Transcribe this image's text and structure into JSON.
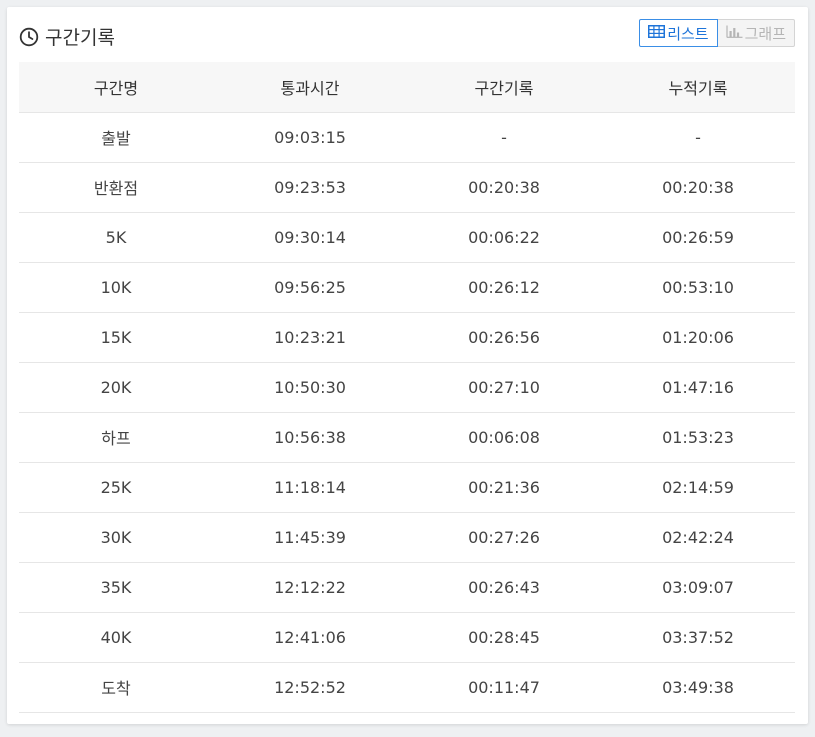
{
  "panel": {
    "title": "구간기록",
    "icon": "clock-icon"
  },
  "view_toggle": {
    "list_label": "리스트",
    "graph_label": "그래프",
    "active": "list",
    "accent_color": "#1e74d9"
  },
  "table": {
    "headers": [
      "구간명",
      "통과시간",
      "구간기록",
      "누적기록"
    ],
    "rows": [
      [
        "출발",
        "09:03:15",
        "-",
        "-"
      ],
      [
        "반환점",
        "09:23:53",
        "00:20:38",
        "00:20:38"
      ],
      [
        "5K",
        "09:30:14",
        "00:06:22",
        "00:26:59"
      ],
      [
        "10K",
        "09:56:25",
        "00:26:12",
        "00:53:10"
      ],
      [
        "15K",
        "10:23:21",
        "00:26:56",
        "01:20:06"
      ],
      [
        "20K",
        "10:50:30",
        "00:27:10",
        "01:47:16"
      ],
      [
        "하프",
        "10:56:38",
        "00:06:08",
        "01:53:23"
      ],
      [
        "25K",
        "11:18:14",
        "00:21:36",
        "02:14:59"
      ],
      [
        "30K",
        "11:45:39",
        "00:27:26",
        "02:42:24"
      ],
      [
        "35K",
        "12:12:22",
        "00:26:43",
        "03:09:07"
      ],
      [
        "40K",
        "12:41:06",
        "00:28:45",
        "03:37:52"
      ],
      [
        "도착",
        "12:52:52",
        "00:11:47",
        "03:49:38"
      ]
    ]
  }
}
